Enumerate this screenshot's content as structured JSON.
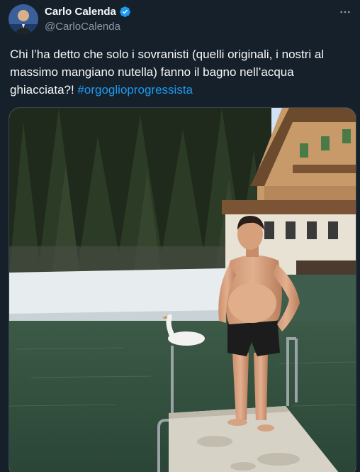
{
  "author": {
    "display_name": "Carlo Calenda",
    "handle": "@CarloCalenda"
  },
  "tweet": {
    "text_part1": "Chi l’ha detto che solo i sovranisti (quelli originali, i nostri al massimo mangiano nutella) fanno il bagno nell’acqua ghiacciata?! ",
    "hashtag": "#orgoglioprogressista"
  },
  "icons": {
    "verified": "verified-badge-icon",
    "more": "more-options-icon"
  },
  "colors": {
    "background": "#15202b",
    "hashtag": "#1d9bf0",
    "verified": "#1d9bf0",
    "secondary_text": "#8b98a5"
  }
}
